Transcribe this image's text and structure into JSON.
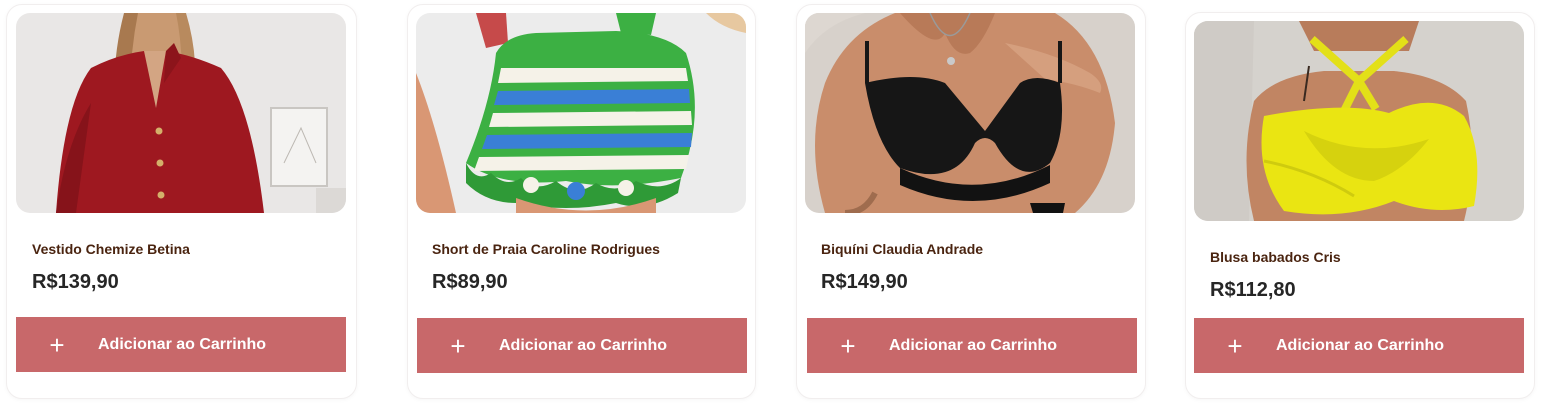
{
  "accent_color": "#c8686a",
  "products": [
    {
      "name": "Vestido Chemize Betina",
      "price": "R$139,90",
      "button_label": "Adicionar ao Carrinho",
      "button_icon": "plus-icon",
      "image": "red-button-dress-photo"
    },
    {
      "name": "Short de Praia Caroline Rodrigues",
      "price": "R$89,90",
      "button_label": "Adicionar ao Carrinho",
      "button_icon": "plus-icon",
      "image": "striped-crochet-shorts-photo"
    },
    {
      "name": "Biquíni Claudia Andrade",
      "price": "R$149,90",
      "button_label": "Adicionar ao Carrinho",
      "button_icon": "plus-icon",
      "image": "black-bikini-top-photo"
    },
    {
      "name": "Blusa babados Cris",
      "price": "R$112,80",
      "button_label": "Adicionar ao Carrinho",
      "button_icon": "plus-icon",
      "image": "yellow-ruffle-blouse-photo"
    }
  ]
}
